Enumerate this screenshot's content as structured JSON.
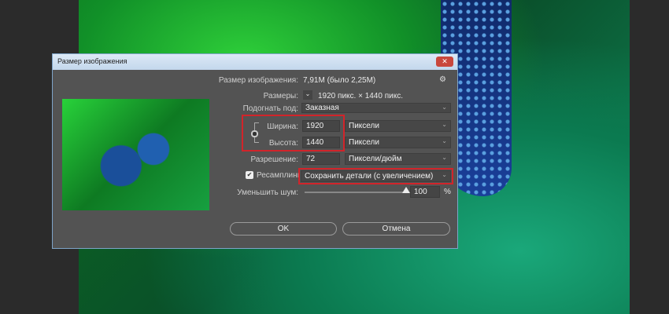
{
  "dialog": {
    "title": "Размер изображения",
    "close": "✕"
  },
  "rows": {
    "image_size_label": "Размер изображения:",
    "image_size_value": "7,91M (было 2,25M)",
    "dimensions_label": "Размеры:",
    "dimensions_value": "1920 пикс.  ×  1440 пикс.",
    "fit_label": "Подогнать под:",
    "fit_value": "Заказная",
    "width_label": "Ширина:",
    "width_value": "1920",
    "width_unit": "Пиксели",
    "height_label": "Высота:",
    "height_value": "1440",
    "height_unit": "Пиксели",
    "resolution_label": "Разрешение:",
    "resolution_value": "72",
    "resolution_unit": "Пиксели/дюйм",
    "resample_label": "Ресамплинг:",
    "resample_value": "Сохранить детали (с увеличением)",
    "resample_checked": true,
    "noise_label": "Уменьшить шум:",
    "noise_value": "100",
    "noise_unit": "%",
    "noise_fraction": 1.0
  },
  "buttons": {
    "ok": "OK",
    "cancel": "Отмена"
  },
  "icons": {
    "gear": "⚙",
    "chevron": "⌄",
    "link": "🔗",
    "check": "✔"
  }
}
